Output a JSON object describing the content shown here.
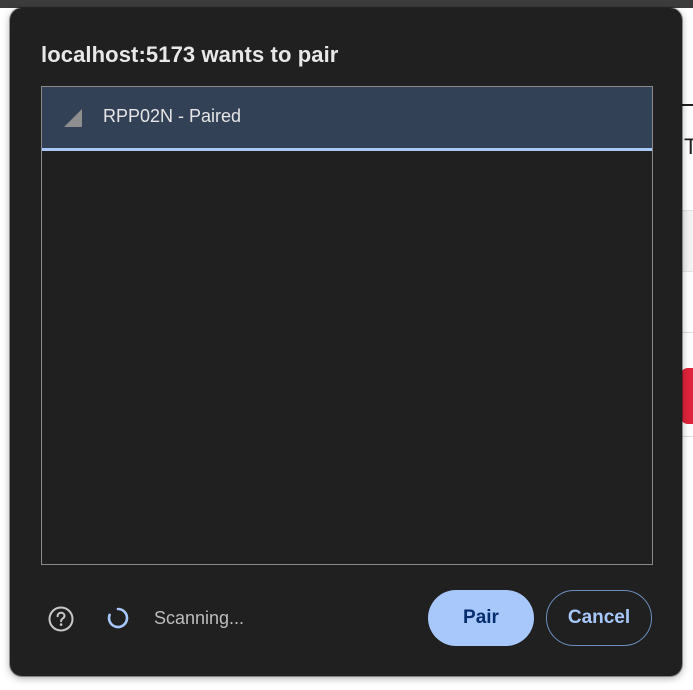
{
  "dialog": {
    "title": "localhost:5173 wants to pair",
    "devices": [
      {
        "label": "RPP02N - Paired",
        "icon": "signal-strength-icon",
        "selected": true
      }
    ],
    "status": {
      "text": "Scanning...",
      "icon": "loading-spinner-icon"
    },
    "help_icon": "help-circle-icon",
    "buttons": {
      "pair_label": "Pair",
      "cancel_label": "Cancel"
    }
  },
  "colors": {
    "dialog_background": "#202020",
    "selected_row": "#334156",
    "accent": "#a8c7fa",
    "accent_text": "#062e6f",
    "background_alert": "#e0243b"
  }
}
